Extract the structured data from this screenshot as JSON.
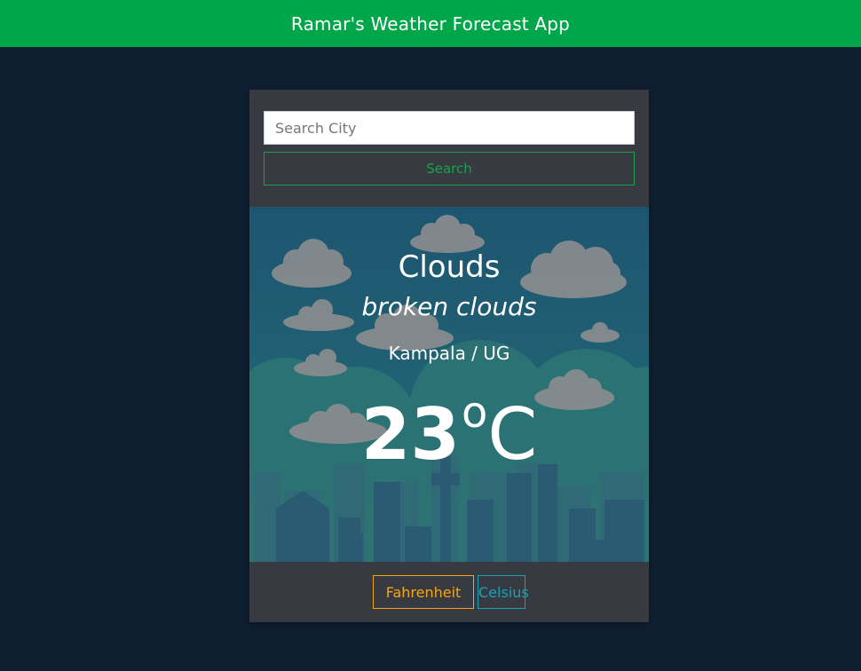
{
  "header": {
    "title": "Ramar's Weather Forecast App"
  },
  "search": {
    "placeholder": "Search City",
    "value": "",
    "button_label": "Search"
  },
  "weather": {
    "main": "Clouds",
    "description": "broken clouds",
    "location": "Kampala / UG",
    "temperature": "23",
    "degree_symbol": "o",
    "unit": "C"
  },
  "units": {
    "fahrenheit_label": "Fahrenheit",
    "celsius_label": "Celsius"
  },
  "colors": {
    "header_bg": "#00a74a",
    "page_bg": "#0f1f31",
    "card_bg": "#373a41",
    "search_accent": "#16a34a",
    "fahrenheit_accent": "#f2a61a",
    "celsius_accent": "#17a2b8"
  }
}
